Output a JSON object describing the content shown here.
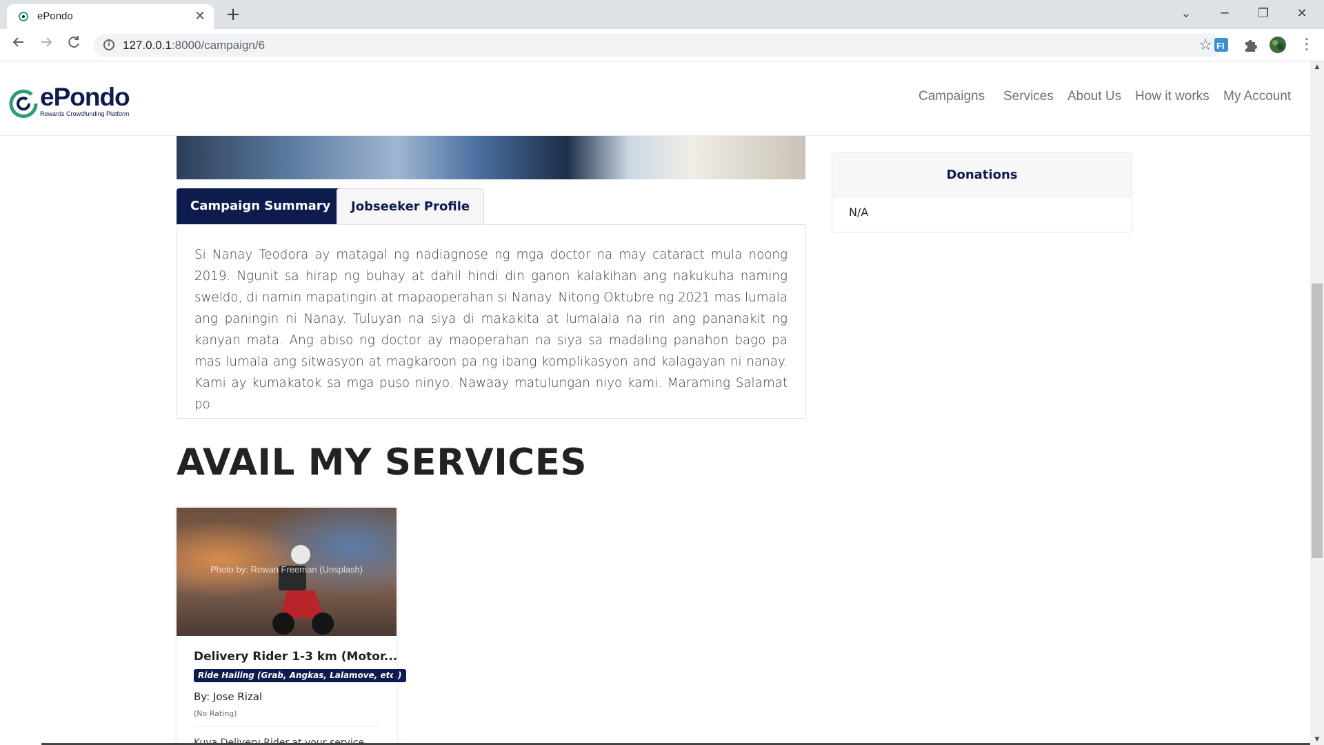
{
  "browser": {
    "tab_title": "ePondo",
    "url_host": "127.0.0.1",
    "url_rest": ":8000/campaign/6",
    "new_tab": "+",
    "close": "✕",
    "minimize": "─",
    "restore": "❐",
    "close_window": "✕",
    "chevron": "⌄"
  },
  "site": {
    "logo_text": "ePondo",
    "logo_tagline": "Rewards Crowdfunding Platform",
    "nav": [
      "Campaigns",
      "Services",
      "About Us",
      "How it works",
      "My Account"
    ]
  },
  "tabs": {
    "active": "Campaign Summary",
    "inactive": "Jobseeker Profile"
  },
  "summary": "Si Nanay Teodora ay matagal ng nadiagnose ng mga doctor na may cataract mula noong 2019. Ngunit sa hirap ng buhay at dahil hindi din ganon kalakihan ang nakukuha naming sweldo, di namin mapatingin at mapaoperahan si Nanay. Nitong Oktubre ng 2021 mas lumala ang paningin ni Nanay. Tuluyan na siya di makakita at lumalala na rin ang pananakit ng kanyan mata. Ang abiso ng doctor ay maoperahan na siya sa madaling panahon bago pa mas lumala ang sitwasyon at magkaroon pa ng ibang komplikasyon and kalagayan ni nanay. Kami ay kumakatok sa mga puso ninyo. Nawaay matulungan niyo kami. Maraming Salamat po",
  "donations": {
    "title": "Donations",
    "value": "N/A"
  },
  "services": {
    "heading": "AVAIL MY SERVICES",
    "card": {
      "image_caption": "Photo by: Rowan Freeman (Unsplash)",
      "title": "Delivery Rider 1-3 km (Motor...",
      "badge": "Ride Hailing (Grab, Angkas, Lalamove, etc.)",
      "by": "By: Jose Rizal",
      "rating": "(No Rating)",
      "description": "Kuya Delivery Rider at your service"
    }
  },
  "colors": {
    "brand_navy": "#0d1b4d",
    "logo_green": "#2e9b7d"
  }
}
